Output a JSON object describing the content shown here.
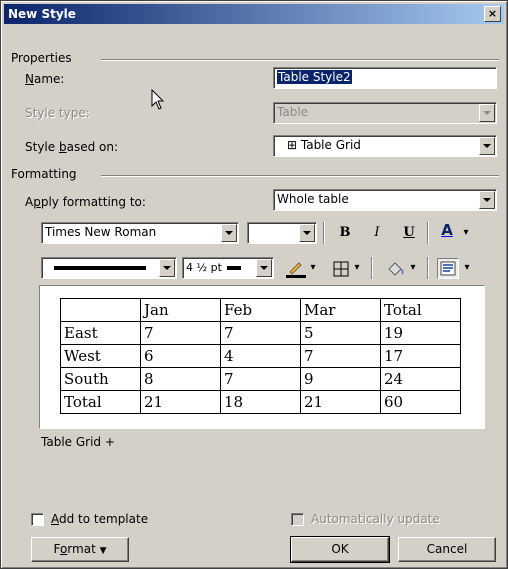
{
  "dialog": {
    "title": "New Style",
    "close_glyph": "×"
  },
  "properties": {
    "group_label": "Properties",
    "name_label": "Name:",
    "name_value": "Table Style2",
    "style_type_label": "Style type:",
    "style_type_value": "Table",
    "based_on_label": "Style based on:",
    "based_on_value": "⊞ Table Grid"
  },
  "formatting": {
    "group_label": "Formatting",
    "apply_label": "Apply formatting to:",
    "apply_value": "Whole table",
    "font_name": "Times New Roman",
    "font_size": "",
    "bold_glyph": "B",
    "italic_glyph": "I",
    "underline_glyph": "U",
    "font_color_glyph": "A",
    "border_width": "4 ½ pt",
    "toolbar_dropdown_glyph": "▾"
  },
  "preview_table": {
    "rows": [
      [
        "",
        "Jan",
        "Feb",
        "Mar",
        "Total"
      ],
      [
        "East",
        "7",
        "7",
        "5",
        "19"
      ],
      [
        "West",
        "6",
        "4",
        "7",
        "17"
      ],
      [
        "South",
        "8",
        "7",
        "9",
        "24"
      ],
      [
        "Total",
        "21",
        "18",
        "21",
        "60"
      ]
    ]
  },
  "description": "Table Grid +",
  "footer": {
    "add_to_template_label": "Add to template",
    "auto_update_label": "Automatically update",
    "format_button": "Format",
    "ok_button": "OK",
    "cancel_button": "Cancel"
  }
}
